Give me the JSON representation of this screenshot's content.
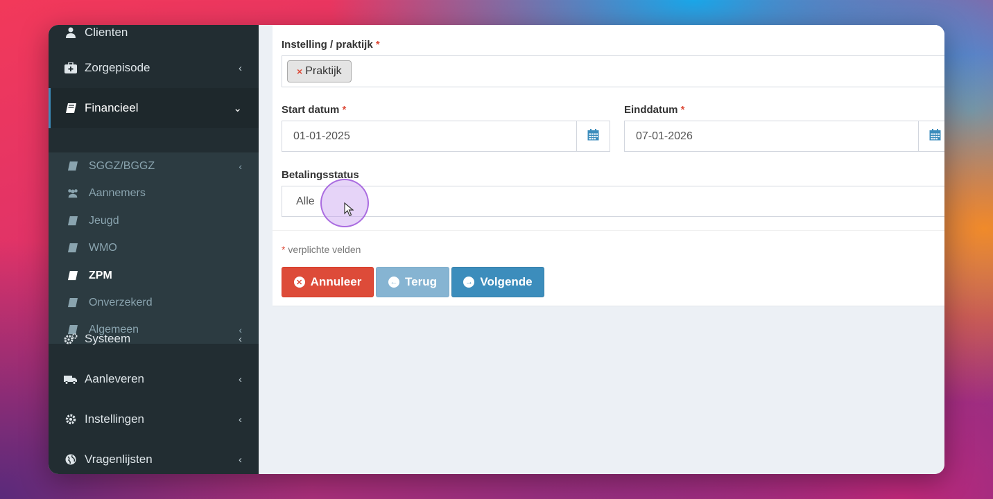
{
  "sidebar": {
    "items": [
      {
        "label": "Clienten",
        "icon": "user-icon"
      },
      {
        "label": "Zorgepisode",
        "icon": "medkit-icon",
        "chevron": "‹"
      },
      {
        "label": "Financieel",
        "icon": "book-icon",
        "chevron": "⌄"
      },
      {
        "label": "Systeem",
        "icon": "cogs-icon",
        "chevron": "‹"
      },
      {
        "label": "Aanleveren",
        "icon": "truck-icon",
        "chevron": "‹"
      },
      {
        "label": "Instellingen",
        "icon": "cog-icon",
        "chevron": "‹"
      },
      {
        "label": "Vragenlijsten",
        "icon": "globe-icon",
        "chevron": "‹"
      }
    ],
    "submenu": [
      {
        "label": "SGGZ/BGGZ",
        "icon": "book-icon",
        "chevron": "‹"
      },
      {
        "label": "Aannemers",
        "icon": "users-icon"
      },
      {
        "label": "Jeugd",
        "icon": "book-icon"
      },
      {
        "label": "WMO",
        "icon": "book-icon"
      },
      {
        "label": "ZPM",
        "icon": "book-icon"
      },
      {
        "label": "Onverzekerd",
        "icon": "book-icon"
      },
      {
        "label": "Algemeen",
        "icon": "book-icon",
        "chevron": "‹"
      }
    ]
  },
  "form": {
    "instelling_label": "Instelling / praktijk",
    "instelling_tag": "Praktijk",
    "tag_remove": "×",
    "start_label": "Start datum",
    "start_value": "01-01-2025",
    "end_label": "Einddatum",
    "end_value": "07-01-2026",
    "status_label": "Betalingsstatus",
    "status_value": "Alle",
    "required_mark": "*",
    "required_note": "verplichte velden"
  },
  "buttons": {
    "cancel": "Annuleer",
    "back": "Terug",
    "next": "Volgende"
  },
  "colors": {
    "sidebar_bg": "#222d32",
    "submenu_bg": "#2c3b41",
    "accent": "#3c8dbc",
    "danger": "#dd4b39"
  }
}
